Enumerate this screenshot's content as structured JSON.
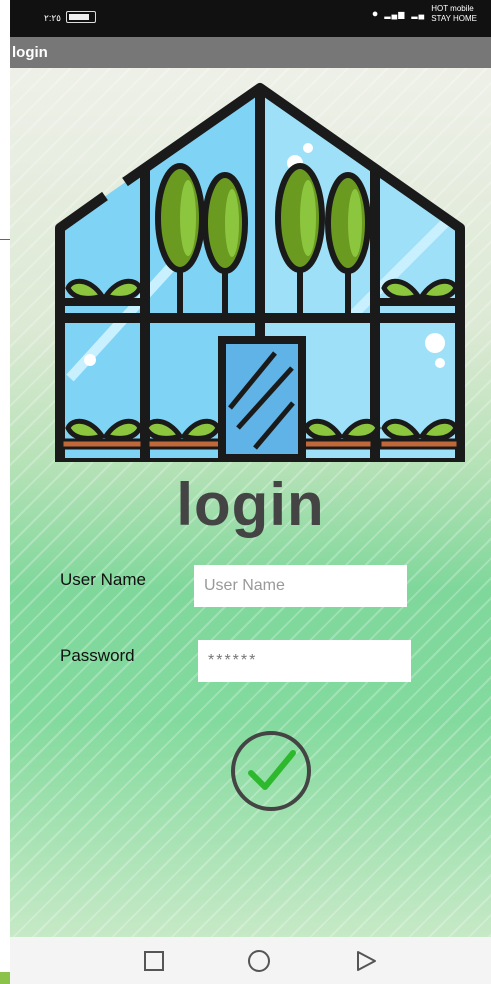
{
  "status_bar": {
    "time": "٢:٢٥",
    "carrier_line1": "HOT mobile",
    "carrier_line2": "STAY HOME"
  },
  "app_bar": {
    "title": "login"
  },
  "main": {
    "title": "login",
    "username_label": "User Name",
    "username_placeholder": "User Name",
    "password_label": "Password",
    "password_value": "******"
  },
  "icons": {
    "logo": "greenhouse-logo-icon",
    "submit": "check-circle-icon",
    "nav": [
      "recents-square-icon",
      "home-circle-icon",
      "back-triangle-icon"
    ]
  },
  "colors": {
    "app_bar": "#777777",
    "title_text": "#444444",
    "check_mark": "#2eb82e",
    "greenhouse_frame": "#1a1a1a",
    "glass": "#7fd3f5",
    "tree": "#6a9a1f"
  }
}
